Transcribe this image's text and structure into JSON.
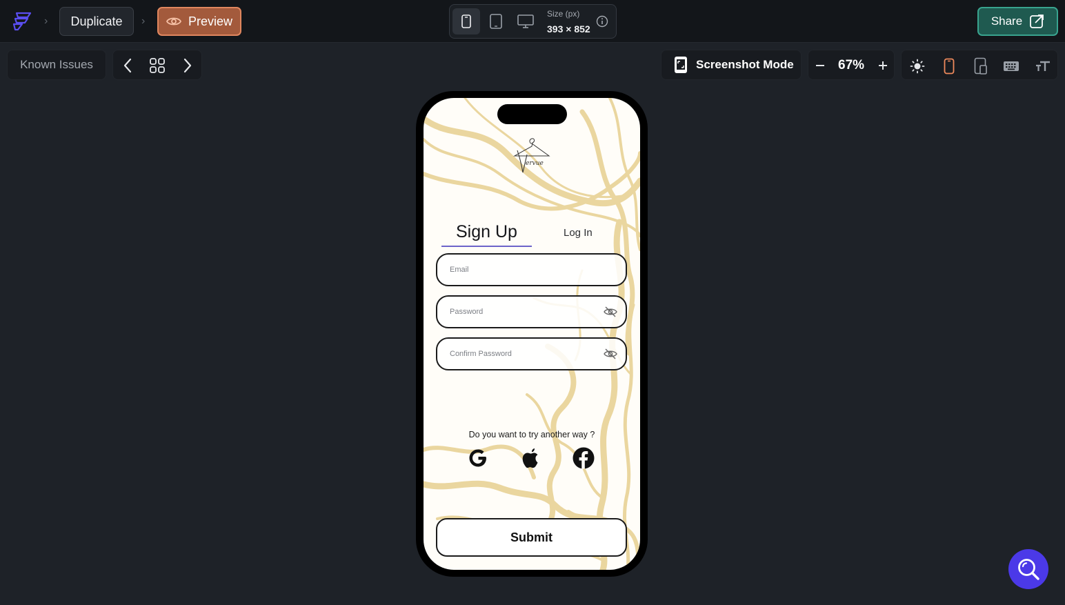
{
  "topbar": {
    "duplicate_label": "Duplicate",
    "preview_label": "Preview",
    "size_label": "Size (px)",
    "size_value": "393 × 852",
    "share_label": "Share"
  },
  "toolbar": {
    "known_issues_label": "Known Issues",
    "screenshot_mode_label": "Screenshot Mode",
    "zoom_value": "67%"
  },
  "app": {
    "tabs": {
      "signup": "Sign Up",
      "login": "Log In"
    },
    "fields": {
      "email_placeholder": "Email",
      "password_placeholder": "Password",
      "confirm_placeholder": "Confirm Password"
    },
    "alt_prompt": "Do you want to try another way ?",
    "social": [
      "google-icon",
      "apple-icon",
      "facebook-icon"
    ],
    "submit_label": "Submit"
  },
  "colors": {
    "preview_accent": "#e1875f",
    "share_accent": "#39a48f",
    "tab_underline": "#6c63c9",
    "search_fab": "#4b39e8",
    "marble": "#e9d49b"
  }
}
